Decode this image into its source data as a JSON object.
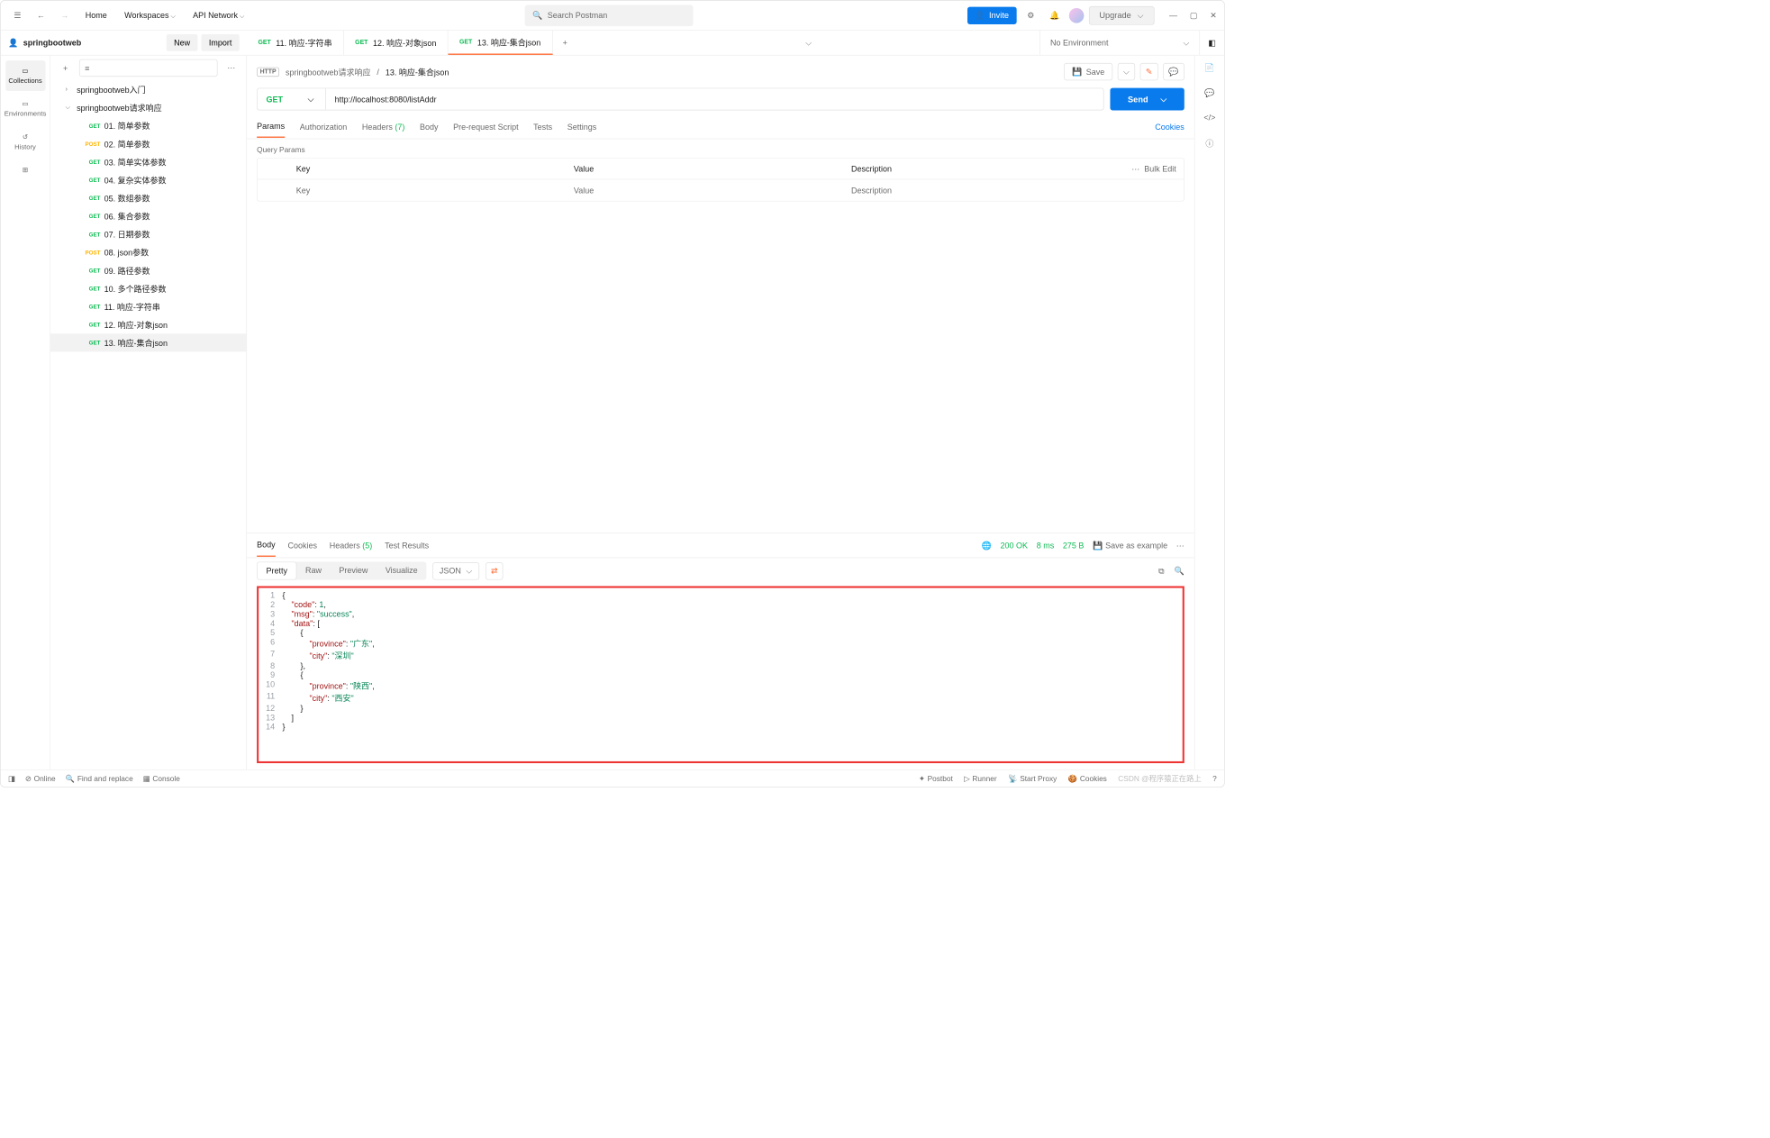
{
  "topbar": {
    "home": "Home",
    "workspaces": "Workspaces",
    "api_network": "API Network",
    "search_placeholder": "Search Postman",
    "invite": "Invite",
    "upgrade": "Upgrade"
  },
  "workspace": {
    "name": "springbootweb",
    "new": "New",
    "import": "Import"
  },
  "leftnav": {
    "collections": "Collections",
    "environments": "Environments",
    "history": "History"
  },
  "tree": {
    "folder1": "springbootweb入门",
    "folder2": "springbootweb请求响应",
    "items": [
      {
        "method": "GET",
        "label": "01. 简单参数"
      },
      {
        "method": "POST",
        "label": "02. 简单参数"
      },
      {
        "method": "GET",
        "label": "03. 简单实体参数"
      },
      {
        "method": "GET",
        "label": "04. 复杂实体参数"
      },
      {
        "method": "GET",
        "label": "05. 数组参数"
      },
      {
        "method": "GET",
        "label": "06. 集合参数"
      },
      {
        "method": "GET",
        "label": "07. 日期参数"
      },
      {
        "method": "POST",
        "label": "08. json参数"
      },
      {
        "method": "GET",
        "label": "09. 路径参数"
      },
      {
        "method": "GET",
        "label": "10. 多个路径参数"
      },
      {
        "method": "GET",
        "label": "11. 响应-字符串"
      },
      {
        "method": "GET",
        "label": "12. 响应-对象json"
      },
      {
        "method": "GET",
        "label": "13. 响应-集合json"
      }
    ]
  },
  "tabs": [
    {
      "method": "GET",
      "label": "11. 响应-字符串"
    },
    {
      "method": "GET",
      "label": "12. 响应-对象json"
    },
    {
      "method": "GET",
      "label": "13. 响应-集合json"
    }
  ],
  "env": "No Environment",
  "breadcrumb": {
    "parent": "springbootweb请求响应",
    "current": "13. 响应-集合json",
    "save": "Save"
  },
  "request": {
    "method": "GET",
    "url": "http://localhost:8080/listAddr",
    "send": "Send"
  },
  "reqtabs": {
    "params": "Params",
    "auth": "Authorization",
    "headers": "Headers",
    "headers_count": "(7)",
    "body": "Body",
    "prereq": "Pre-request Script",
    "tests": "Tests",
    "settings": "Settings",
    "cookies": "Cookies"
  },
  "query_params_label": "Query Params",
  "table": {
    "key": "Key",
    "value": "Value",
    "desc": "Description",
    "bulk": "Bulk Edit",
    "key_ph": "Key",
    "value_ph": "Value",
    "desc_ph": "Description"
  },
  "resp_tabs": {
    "body": "Body",
    "cookies": "Cookies",
    "headers": "Headers",
    "headers_count": "(5)",
    "test_results": "Test Results"
  },
  "resp_meta": {
    "status": "200 OK",
    "time": "8 ms",
    "size": "275 B",
    "save_example": "Save as example"
  },
  "view": {
    "pretty": "Pretty",
    "raw": "Raw",
    "preview": "Preview",
    "visualize": "Visualize",
    "format": "JSON"
  },
  "response_body": {
    "code": 1,
    "msg": "success",
    "data": [
      {
        "province": "广东",
        "city": "深圳"
      },
      {
        "province": "陕西",
        "city": "西安"
      }
    ]
  },
  "statusbar": {
    "online": "Online",
    "find": "Find and replace",
    "console": "Console",
    "postbot": "Postbot",
    "runner": "Runner",
    "proxy": "Start Proxy",
    "cookies": "Cookies",
    "watermark": "CSDN @程序猿正在路上"
  }
}
